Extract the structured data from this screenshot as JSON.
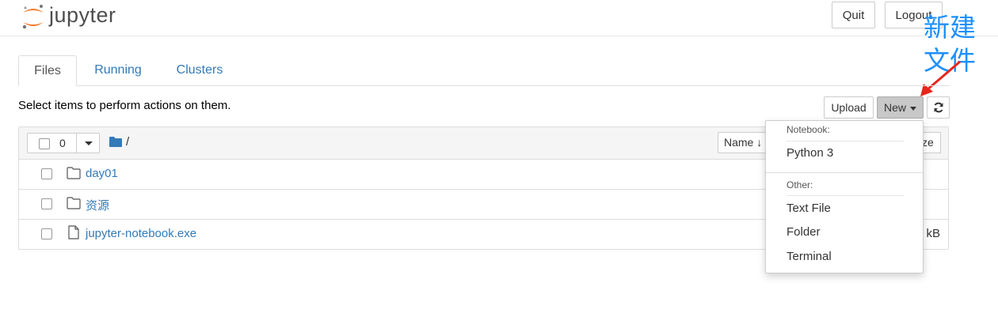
{
  "app": {
    "name": "jupyter"
  },
  "header": {
    "quit_label": "Quit",
    "logout_label": "Logout"
  },
  "annotation": {
    "line1": "新建",
    "line2": "文件",
    "color": "#1e90ff"
  },
  "tabs": [
    {
      "label": "Files",
      "active": true
    },
    {
      "label": "Running",
      "active": false
    },
    {
      "label": "Clusters",
      "active": false
    }
  ],
  "toolbar": {
    "instructions": "Select items to perform actions on them.",
    "upload_label": "Upload",
    "new_label": "New",
    "refresh_icon": "refresh-icon"
  },
  "list_header": {
    "selected_count": "0",
    "path": "/",
    "sort_label": "Name",
    "size_label_fragment": "ze"
  },
  "files": [
    {
      "name": "day01",
      "type": "folder",
      "size": ""
    },
    {
      "name": "资源",
      "type": "folder",
      "size": ""
    },
    {
      "name": "jupyter-notebook.exe",
      "type": "file",
      "size": "kB"
    }
  ],
  "new_menu": {
    "notebook_header": "Notebook:",
    "notebook_items": [
      "Python 3"
    ],
    "other_header": "Other:",
    "other_items": [
      "Text File",
      "Folder",
      "Terminal"
    ]
  },
  "colors": {
    "link": "#337ab7",
    "logo_orange": "#f37726",
    "arrow": "#e8261c"
  }
}
